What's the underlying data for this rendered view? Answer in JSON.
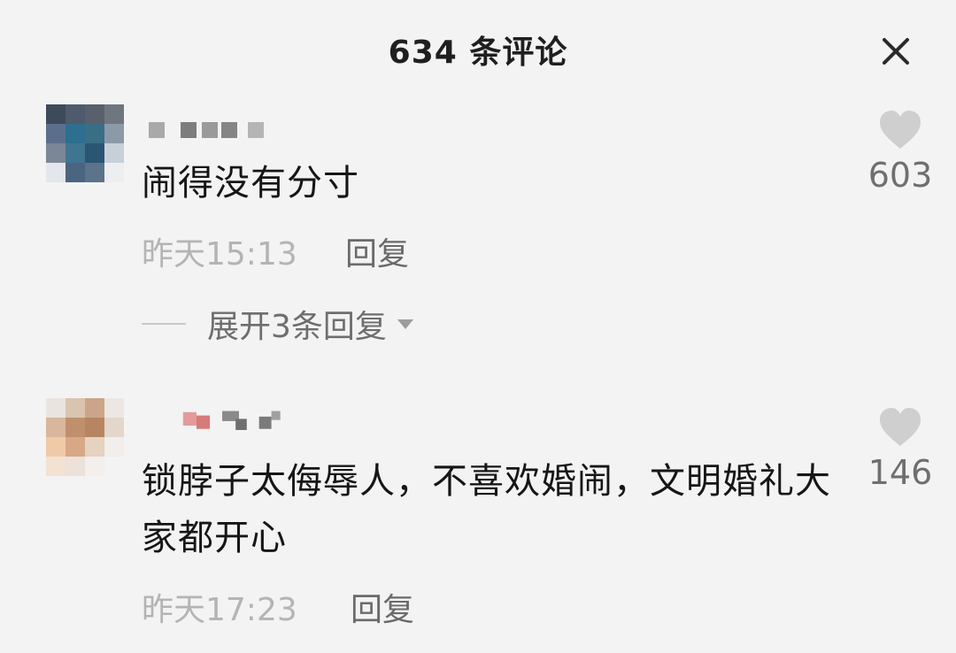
{
  "header": {
    "title": "634 条评论",
    "close_icon": "close-icon"
  },
  "comments": [
    {
      "text": "闹得没有分寸",
      "time": "昨天15:13",
      "reply_label": "回复",
      "likes": "603",
      "expand_label": "展开3条回复",
      "avatar": "pixelated-avatar",
      "username": "pixelated-username"
    },
    {
      "text": "锁脖子太侮辱人，不喜欢婚闹，文明婚礼大家都开心",
      "time": "昨天17:23",
      "reply_label": "回复",
      "likes": "146",
      "avatar": "pixelated-avatar",
      "username": "pixelated-username"
    }
  ],
  "colors": {
    "background": "#f3f3f3",
    "primary_text": "#161616",
    "secondary_text": "#b4b4b4",
    "action_text": "#6a6a6a",
    "heart": "#cfcfcf"
  }
}
